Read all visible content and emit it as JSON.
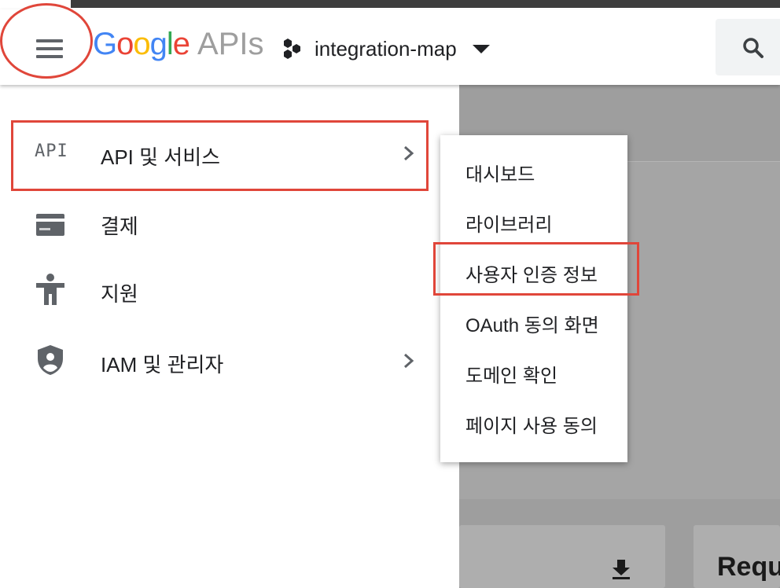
{
  "header": {
    "logo_google": [
      "G",
      "o",
      "o",
      "g",
      "l",
      "e"
    ],
    "logo_apis": "APIs",
    "project_name": "integration-map"
  },
  "nav": {
    "items": [
      {
        "label": "API 및 서비스",
        "icon": "api-icon",
        "icon_text": "API",
        "has_submenu": true
      },
      {
        "label": "결제",
        "icon": "credit-card-icon",
        "has_submenu": false
      },
      {
        "label": "지원",
        "icon": "accessibility-person-icon",
        "has_submenu": false
      },
      {
        "label": "IAM 및 관리자",
        "icon": "security-shield-icon",
        "has_submenu": true
      }
    ]
  },
  "submenu": {
    "items": [
      {
        "label": "대시보드"
      },
      {
        "label": "라이브러리"
      },
      {
        "label": "사용자 인증 정보"
      },
      {
        "label": "OAuth 동의 화면"
      },
      {
        "label": "도메인 확인"
      },
      {
        "label": "페이지 사용 동의"
      }
    ]
  },
  "content": {
    "partial_heading": "Requ"
  },
  "colors": {
    "highlight": "#e0463a",
    "google_blue": "#4285f4",
    "google_red": "#ea4335",
    "google_yellow": "#fbbc05",
    "google_green": "#34a853",
    "icon_gray": "#5f6368",
    "backdrop": "#9e9e9e"
  }
}
